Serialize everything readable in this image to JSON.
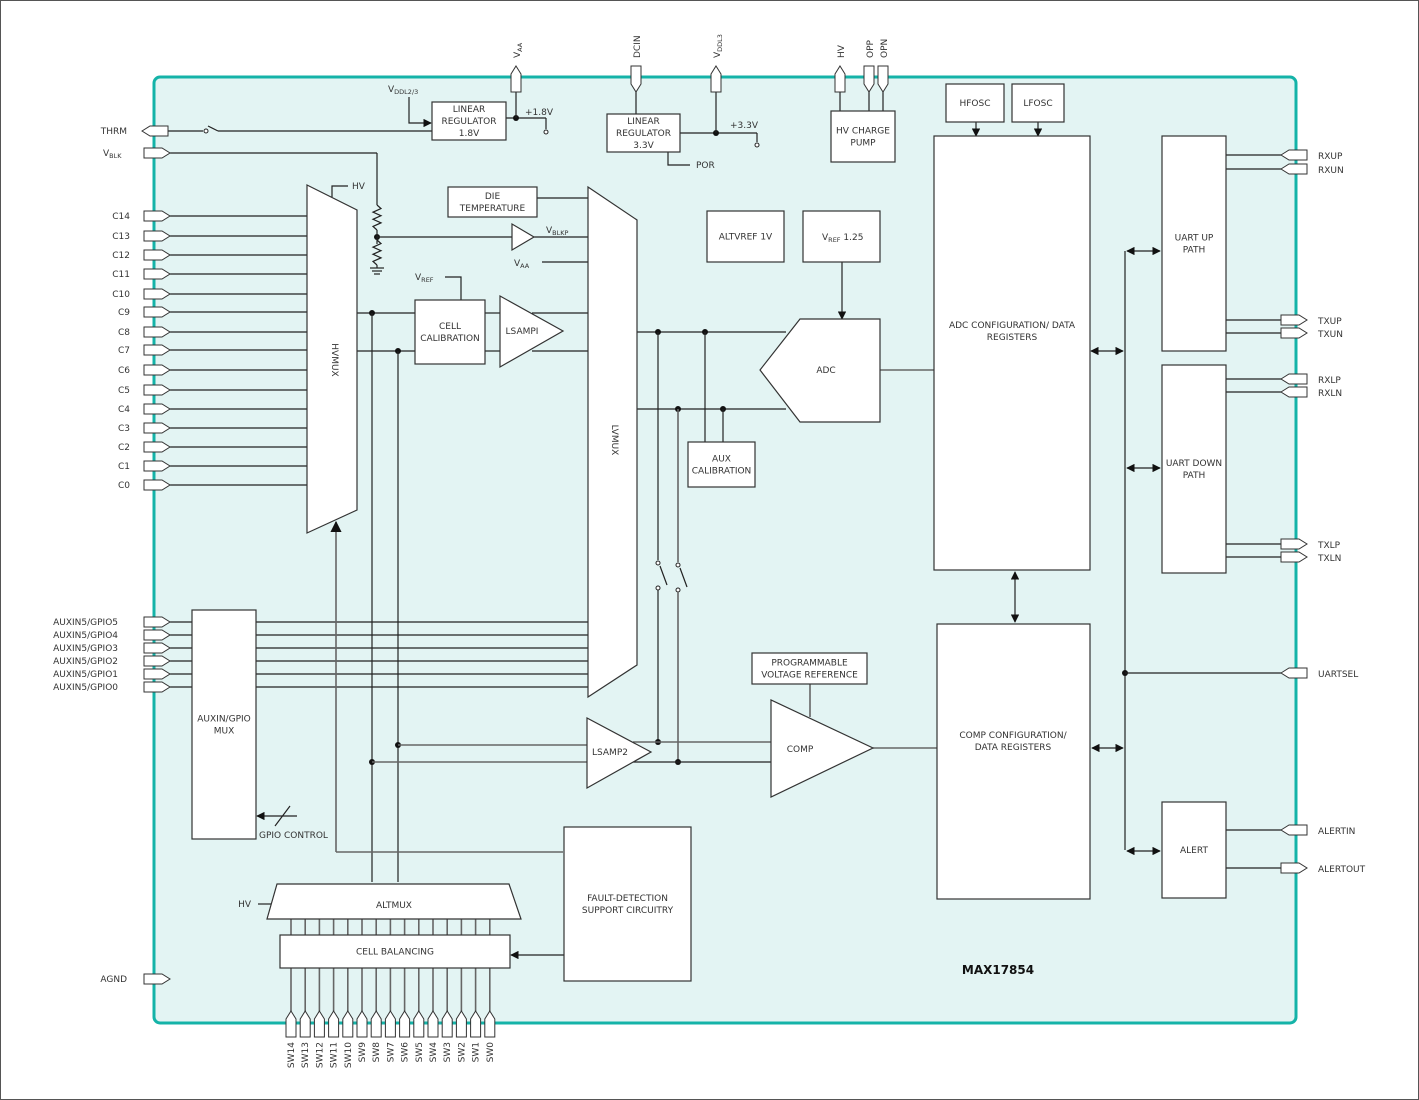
{
  "diagram": {
    "part_number": "MAX17854",
    "colors": {
      "chip_fill": "#e3f4f3",
      "chip_border": "#14b3a8",
      "line": "#222222"
    },
    "left_pins": {
      "thrm": "THRM",
      "vblk": "V",
      "vblk_sub": "BLK",
      "cells": [
        "C14",
        "C13",
        "C12",
        "C11",
        "C10",
        "C9",
        "C8",
        "C7",
        "C6",
        "C5",
        "C4",
        "C3",
        "C2",
        "C1",
        "C0"
      ],
      "aux": [
        "AUXIN5/GPIO5",
        "AUXIN5/GPIO4",
        "AUXIN5/GPIO3",
        "AUXIN5/GPIO2",
        "AUXIN5/GPIO1",
        "AUXIN5/GPIO0"
      ],
      "agnd": "AGND"
    },
    "top_pins": {
      "vaa": "V",
      "vaa_sub": "AA",
      "dcin": "DCIN",
      "vddl3": "V",
      "vddl3_sub": "DDL3",
      "hv": "HV",
      "opp": "OPP",
      "opn": "OPN"
    },
    "right_pins": [
      "RXUP",
      "RXUN",
      "TXUP",
      "TXUN",
      "RXLP",
      "RXLN",
      "TXLP",
      "TXLN",
      "UARTSEL",
      "ALERTIN",
      "ALERTOUT"
    ],
    "bottom_pins": [
      "SW14",
      "SW13",
      "SW12",
      "SW11",
      "SW10",
      "SW9",
      "SW8",
      "SW7",
      "SW6",
      "SW5",
      "SW4",
      "SW3",
      "SW2",
      "SW1",
      "SW0"
    ],
    "blocks": {
      "lin_reg_18": [
        "LINEAR",
        "REGULATOR",
        "1.8V"
      ],
      "lin_reg_33": [
        "LINEAR",
        "REGULATOR",
        "3.3V"
      ],
      "hv_charge_pump": [
        "HV CHARGE",
        "PUMP"
      ],
      "hfosc": "HFOSC",
      "lfosc": "LFOSC",
      "die_temp": [
        "DIE",
        "TEMPERATURE"
      ],
      "altvref": "ALTVREF 1V",
      "vref": "V",
      "vref_sub": "REF",
      "vref_val": " 1.25",
      "cell_cal": [
        "CELL",
        "CALIBRATION"
      ],
      "lsamp1": "LSAMPI",
      "lsamp2": "LSAMP2",
      "hvmux": "HVMUX",
      "lvmux": "LVMUX",
      "adc": "ADC",
      "aux_cal": [
        "AUX",
        "CALIBRATION"
      ],
      "adc_regs": [
        "ADC CONFIGURATION/ DATA",
        "REGISTERS"
      ],
      "comp_regs": [
        "COMP CONFIGURATION/",
        "DATA REGISTERS"
      ],
      "uart_up": [
        "UART UP",
        "PATH"
      ],
      "uart_down": [
        "UART DOWN",
        "PATH"
      ],
      "alert": "ALERT",
      "prog_vref": [
        "PROGRAMMABLE",
        "VOLTAGE REFERENCE"
      ],
      "comp": "COMP",
      "auxin_mux": [
        "AUXIN/GPIO",
        "MUX"
      ],
      "fault_det": [
        "FAULT-DETECTION",
        "SUPPORT CIRCUITRY"
      ],
      "altmux": "ALTMUX",
      "cell_bal": "CELL BALANCING"
    },
    "net_labels": {
      "vddl23": "V",
      "vddl23_sub": "DDL2/3",
      "plus18": "+1.8V",
      "plus33": "+3.3V",
      "por": "POR",
      "hv_hvmux": "HV",
      "vblkp": "V",
      "vblkp_sub": "BLKP",
      "vaa_in": "V",
      "vaa_in_sub": "AA",
      "vref_in": "V",
      "vref_in_sub": "REF",
      "gpio_control": "GPIO CONTROL",
      "hv_altmux": "HV"
    }
  }
}
